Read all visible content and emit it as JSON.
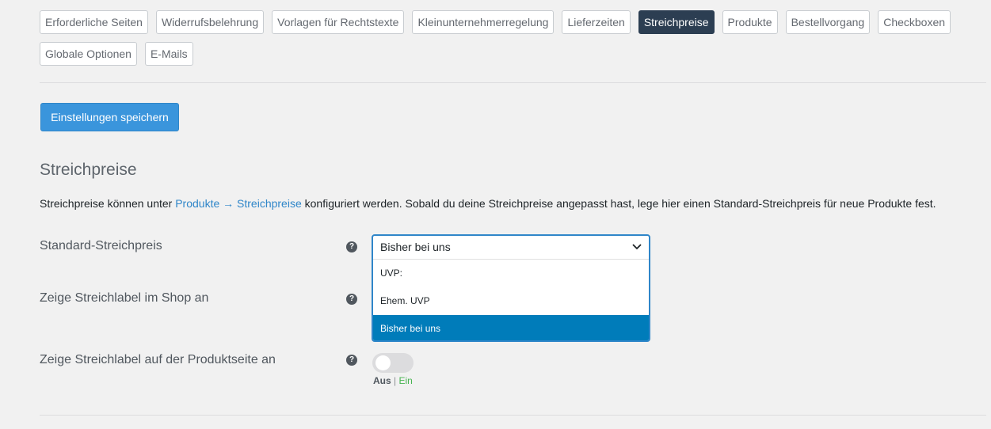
{
  "tabs": {
    "row1": [
      {
        "label": "Erforderliche Seiten",
        "active": false
      },
      {
        "label": "Widerrufsbelehrung",
        "active": false
      },
      {
        "label": "Vorlagen für Rechtstexte",
        "active": false
      },
      {
        "label": "Kleinunternehmerregelung",
        "active": false
      },
      {
        "label": "Lieferzeiten",
        "active": false
      },
      {
        "label": "Streichpreise",
        "active": true
      },
      {
        "label": "Produkte",
        "active": false
      },
      {
        "label": "Bestellvorgang",
        "active": false
      },
      {
        "label": "Checkboxen",
        "active": false
      }
    ],
    "row2": [
      {
        "label": "Globale Optionen",
        "active": false
      },
      {
        "label": "E-Mails",
        "active": false
      }
    ]
  },
  "save_button": {
    "label": "Einstellungen speichern"
  },
  "section": {
    "title": "Streichpreise",
    "desc_before": "Streichpreise können unter ",
    "desc_link": "Produkte → Streichpreise",
    "desc_after": " konfiguriert werden. Sobald du deine Streichpreise angepasst hast, lege hier einen Standard-Streichpreis für neue Produkte fest."
  },
  "fields": {
    "standard_price": {
      "label": "Standard-Streichpreis",
      "help": "?",
      "selected": "Bisher bei uns",
      "options": [
        "UVP:",
        "Ehem. UVP",
        "Bisher bei uns"
      ]
    },
    "shop_label": {
      "label": "Zeige Streichlabel im Shop an",
      "help": "?"
    },
    "product_label": {
      "label": "Zeige Streichlabel auf der Produktseite an",
      "help": "?",
      "off_text": "Aus",
      "separator": "|",
      "on_text": "Ein"
    }
  },
  "colors": {
    "active_tab": "#2c3e52",
    "primary_button": "#3a95dc",
    "selected_option": "#007cba",
    "link": "#2f86c9",
    "toggle_on_text": "#46b450"
  }
}
